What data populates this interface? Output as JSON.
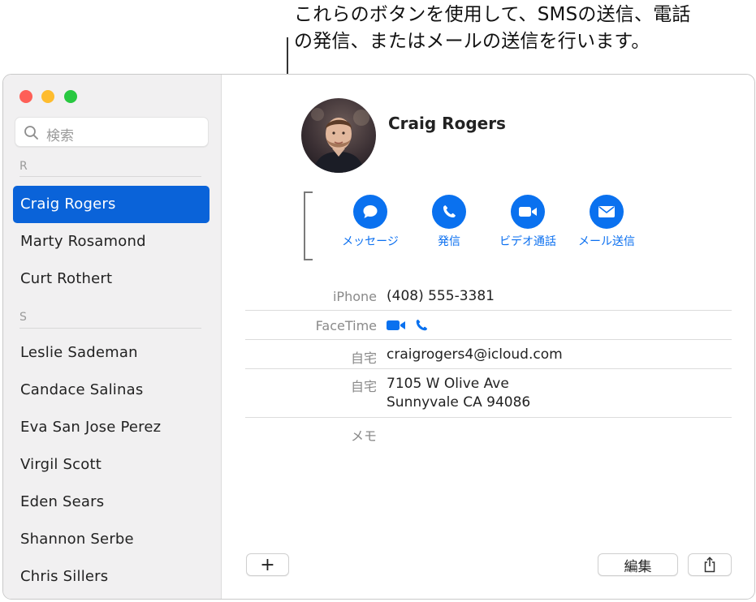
{
  "callout": {
    "line1": "これらのボタンを使用して、SMSの送信、電話",
    "line2": "の発信、またはメールの送信を行います。"
  },
  "search": {
    "placeholder": "検索"
  },
  "sections": [
    {
      "letter": "R",
      "contacts": [
        "Craig Rogers",
        "Marty Rosamond",
        "Curt Rothert"
      ]
    },
    {
      "letter": "S",
      "contacts": [
        "Leslie Sademan",
        "Candace Salinas",
        "Eva San Jose Perez",
        "Virgil Scott",
        "Eden Sears",
        "Shannon Serbe",
        "Chris Sillers"
      ]
    }
  ],
  "selected_contact": "Craig Rogers",
  "card": {
    "name": "Craig Rogers",
    "actions": [
      {
        "label": "メッセージ",
        "icon": "message-bubble-icon"
      },
      {
        "label": "発信",
        "icon": "phone-icon"
      },
      {
        "label": "ビデオ通話",
        "icon": "video-camera-icon"
      },
      {
        "label": "メール送信",
        "icon": "envelope-icon"
      }
    ],
    "fields": {
      "phone_label": "iPhone",
      "phone_value": "(408) 555-3381",
      "facetime_label": "FaceTime",
      "email_label": "自宅",
      "email_value": "craigrogers4@icloud.com",
      "address_label": "自宅",
      "address_line1": "7105 W Olive Ave",
      "address_line2": "Sunnyvale CA 94086",
      "memo_label": "メモ"
    }
  },
  "toolbar": {
    "add_label": "+",
    "edit_label": "編集",
    "share_icon": "share-icon"
  },
  "colors": {
    "accent": "#0a71ef",
    "selection": "#0a63d9",
    "close": "#fe5f57",
    "minimize": "#febc2e",
    "maximize": "#28c840"
  }
}
